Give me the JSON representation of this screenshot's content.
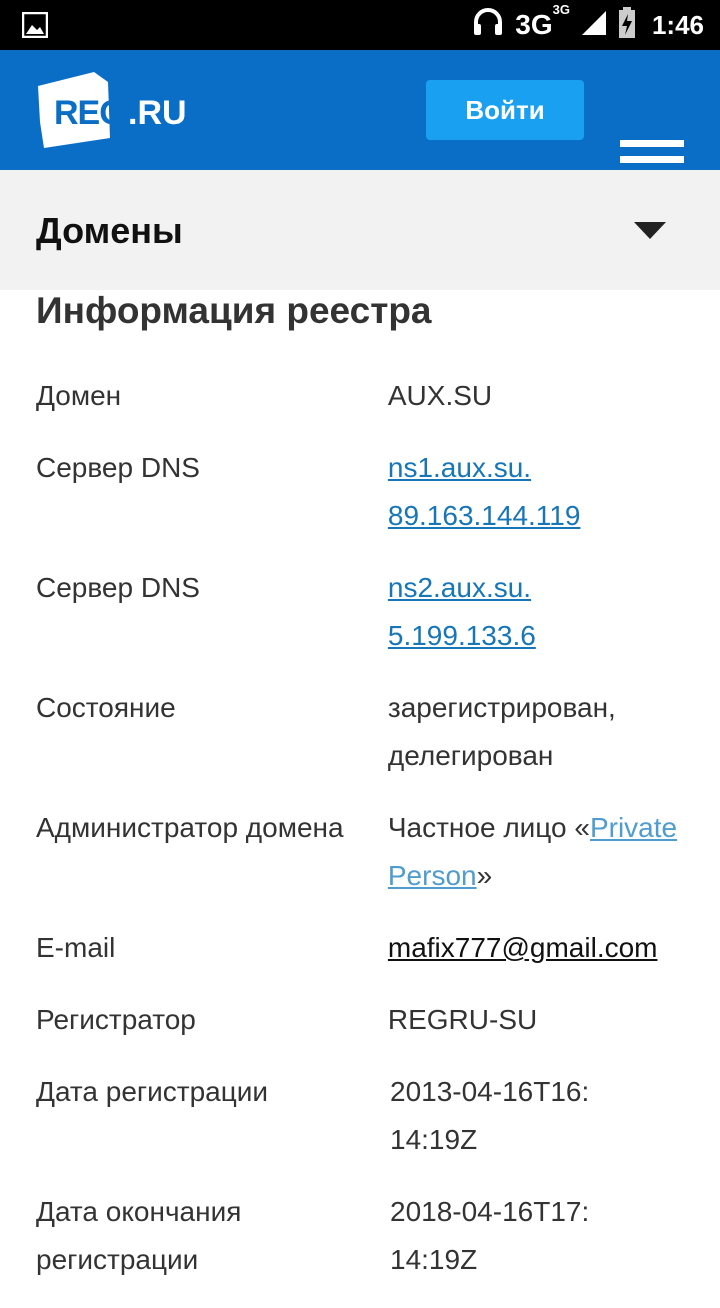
{
  "statusbar": {
    "network": "3G",
    "network_sup": "3G",
    "time": "1:46",
    "icons": [
      "image-icon",
      "headset-icon",
      "signal-icon",
      "battery-charging-icon"
    ]
  },
  "header": {
    "logo_text": "REG",
    "logo_suffix": ".RU",
    "login_label": "Войти",
    "menu_icon": "hamburger-menu-icon",
    "brand_color": "#0a6ec7",
    "button_color": "#1aa0f0"
  },
  "section": {
    "title": "Домены",
    "toggle_icon": "chevron-down-icon"
  },
  "info": {
    "title": "Информация реестра",
    "rows": [
      {
        "label": "Домен",
        "value": "AUX.SU"
      },
      {
        "label": "Сервер DNS",
        "link1": "ns1.aux.su.",
        "link2": "89.163.144.119"
      },
      {
        "label": "Сервер DNS",
        "link1": "ns2.aux.su.",
        "link2": "5.199.133.6"
      },
      {
        "label": "Состояние",
        "value": "зарегистрирован, делегирован"
      },
      {
        "label": "Администратор домена",
        "value_prefix": "Частное лицо «",
        "link": "Private Person",
        "value_suffix": "»"
      },
      {
        "label": "E-mail",
        "link": "mafix777@gmail.com"
      },
      {
        "label": "Регистратор",
        "value": "REGRU-SU"
      },
      {
        "label": "Дата регистрации",
        "value": "2013-04-16T16:14:19Z"
      },
      {
        "label": "Дата окончания регистрации",
        "value": "2018-04-16T17:14:19Z"
      }
    ]
  }
}
